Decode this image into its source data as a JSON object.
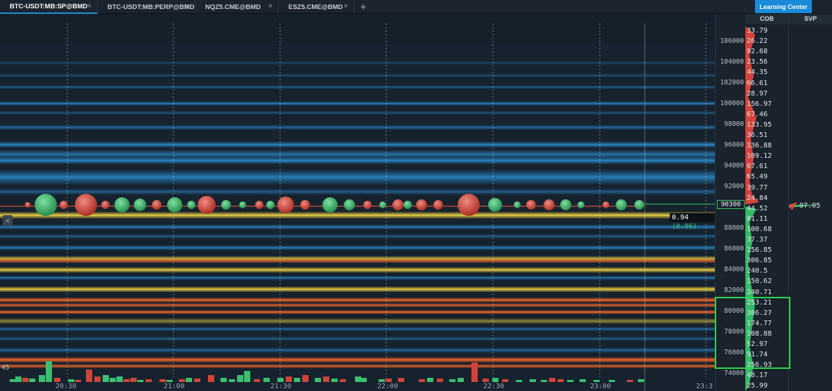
{
  "tabs": [
    {
      "label": "BTC-USDT:MB:SP@BMD",
      "close": "×"
    },
    {
      "label": "BTC-USDT:MB:PERP@BMD",
      "close": "×"
    },
    {
      "label": "NQZ5.CME@BMD",
      "close": "×"
    },
    {
      "label": "ESZ5.CME@BMD",
      "close": "×"
    }
  ],
  "toolbar": {
    "add_tab": "+",
    "learning_center": "Learning Center"
  },
  "chart": {
    "collapse_label": "<",
    "volume_scale": "45",
    "last_trade_size": "0.94",
    "last_trade_change": "(0.06)"
  },
  "price_axis": {
    "labels": [
      "106000",
      "104000",
      "102000",
      "100000",
      "98000",
      "96000",
      "94000",
      "92000",
      "90300",
      "88000",
      "86000",
      "84000",
      "82000",
      "80000",
      "78000",
      "76000",
      "74000"
    ],
    "current": "90300"
  },
  "time_axis": {
    "labels": [
      "20:30",
      "21:00",
      "21:30",
      "22:00",
      "22:30",
      "23:00",
      "23:3"
    ]
  },
  "cob": {
    "header": "COB",
    "values": [
      "33.79",
      "26.22",
      "92.68",
      "23.56",
      "44.35",
      "66.61",
      "28.97",
      "156.97",
      "67.46",
      "133.95",
      "36.51",
      "136.88",
      "109.12",
      "67.61",
      "65.49",
      "39.77",
      "24.84",
      "44.52",
      "81.11",
      "100.68",
      "37.37",
      "156.85",
      "306.85",
      "240.5",
      "150.62",
      "240.71",
      "253.21",
      "306.27",
      "174.77",
      "108.88",
      "52.97",
      "91.74",
      "256.93",
      "48.17",
      "25.99"
    ]
  },
  "svp": {
    "header": "SVP",
    "value": "97.05"
  },
  "colors": {
    "bid": "#35c46a",
    "ask": "#e0463c",
    "accent": "#1a8bd8",
    "heatmap_blue": "#1f6ea8",
    "heatmap_orange": "#e0582a",
    "heatmap_yellow": "#d8c03a"
  }
}
